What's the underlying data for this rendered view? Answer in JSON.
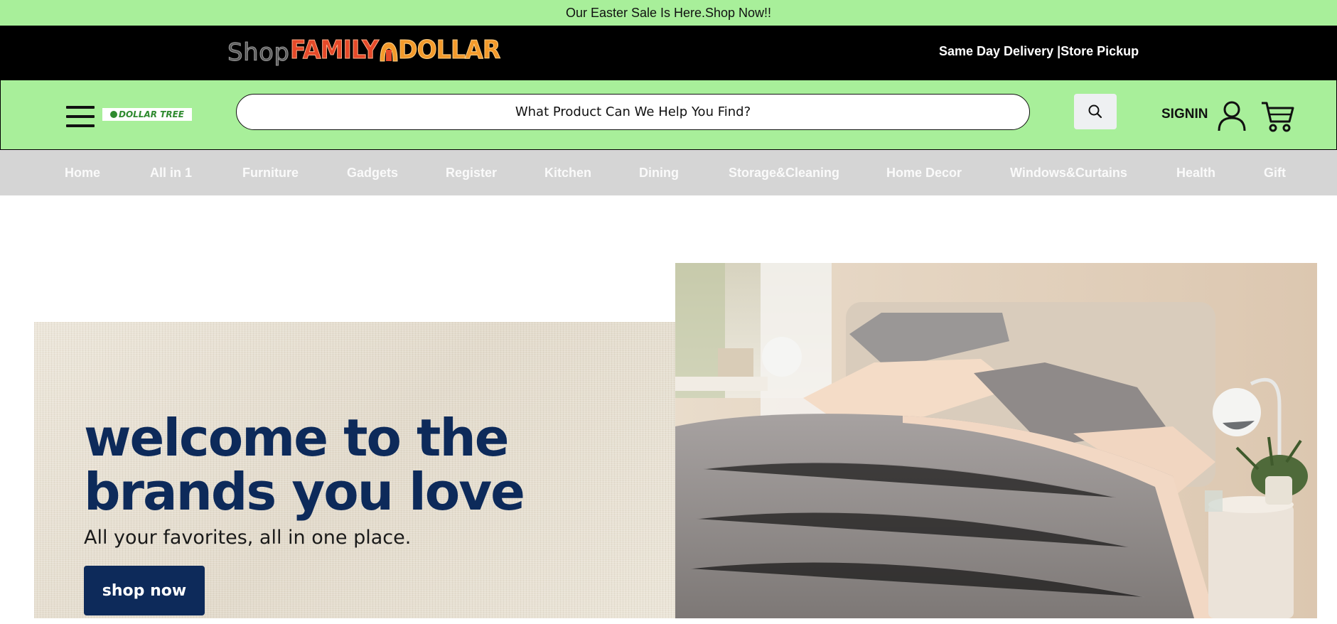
{
  "promo": {
    "text": "Our Easter Sale Is Here.Shop Now!!"
  },
  "brand": {
    "logo_shop": "Shop",
    "logo_family": "FAMILY",
    "logo_dollar": "DOLLAR",
    "delivery": "Same Day Delivery |Store Pickup"
  },
  "header": {
    "menu_icon": "hamburger-menu-icon",
    "dt_logo": "DOLLAR TREE",
    "search_placeholder": "What Product Can We Help You Find?",
    "search_icon": "search-icon",
    "signin": "SIGNIN",
    "user_icon": "user-icon",
    "cart_icon": "cart-icon"
  },
  "nav": {
    "items": [
      {
        "label": "Home"
      },
      {
        "label": "All in 1"
      },
      {
        "label": "Furniture"
      },
      {
        "label": "Gadgets"
      },
      {
        "label": "Register"
      },
      {
        "label": "Kitchen"
      },
      {
        "label": "Dining"
      },
      {
        "label": "Storage&Cleaning"
      },
      {
        "label": "Home Decor"
      },
      {
        "label": "Windows&Curtains"
      },
      {
        "label": "Health"
      },
      {
        "label": "Gift"
      }
    ]
  },
  "hero": {
    "title": "welcome to the brands you love",
    "subtitle": "All your favorites, all in one place.",
    "cta": "shop now"
  },
  "colors": {
    "promo_bg": "#a8ef9a",
    "brand_bar_bg": "#000000",
    "nav_bg": "#d5d5d5",
    "hero_title": "#0d2a5a",
    "cta_bg": "#0d2a5a"
  }
}
